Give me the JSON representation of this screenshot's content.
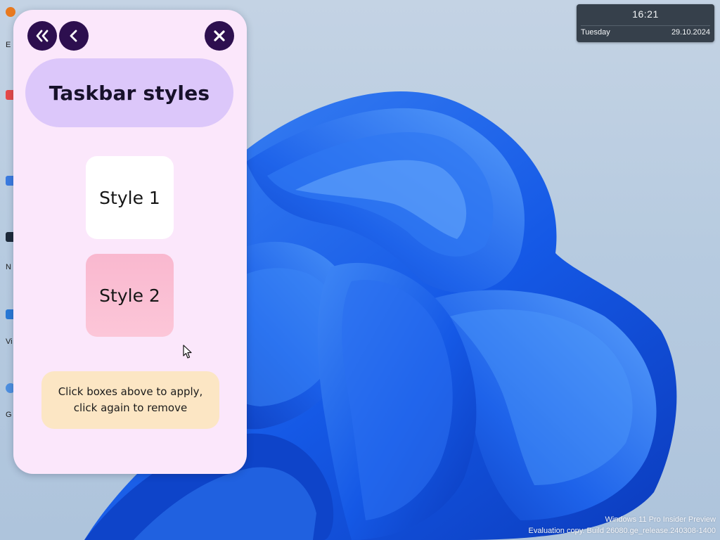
{
  "desktop": {
    "icon_labels": [
      "E",
      "N",
      "Vi",
      "G"
    ]
  },
  "clock_widget": {
    "time": "16:21",
    "day": "Tuesday",
    "date": "29.10.2024"
  },
  "watermark": {
    "line1": "Windows 11 Pro Insider Preview",
    "line2": "Evaluation copy. Build 26080.ge_release.240308-1400"
  },
  "panel": {
    "title": "Taskbar styles",
    "buttons": {
      "back_all_icon": "double-chevron-left-icon",
      "back_icon": "chevron-left-icon",
      "close_icon": "close-icon"
    },
    "styles": [
      {
        "label": "Style 1",
        "color": "#ffffff"
      },
      {
        "label": "Style 2",
        "color": "#fbbfd4"
      }
    ],
    "info": {
      "line1": "Click boxes above to apply,",
      "line2": "click again to remove"
    },
    "colors": {
      "panel_bg": "#fbe7fb",
      "title_bg": "#dcc7fa",
      "button_bg": "#2d0f4f",
      "info_bg": "#fce6c4"
    }
  }
}
